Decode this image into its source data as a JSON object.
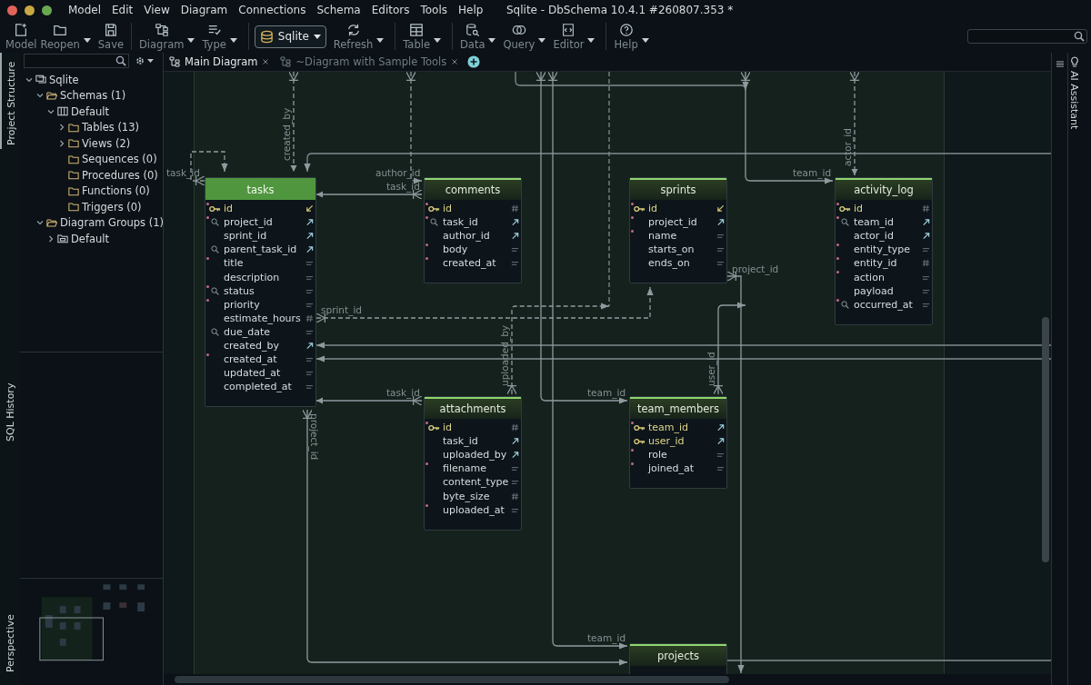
{
  "window": {
    "title": "Sqlite - DbSchema 10.4.1 #260807.353 *"
  },
  "menu": [
    "Model",
    "Edit",
    "View",
    "Diagram",
    "Connections",
    "Schema",
    "Editors",
    "Tools",
    "Help"
  ],
  "toolbar": [
    {
      "label": "Model",
      "kind": "new",
      "dropdown": false
    },
    {
      "label": "Reopen",
      "kind": "folder",
      "dropdown": true
    },
    {
      "label": "Save",
      "kind": "save",
      "dropdown": false
    },
    {
      "label": "Diagram",
      "kind": "diagram",
      "dropdown": true
    },
    {
      "label": "Type",
      "kind": "type",
      "dropdown": true
    },
    {
      "label": "Sqlite",
      "kind": "connection",
      "dropdown": true
    },
    {
      "label": "Refresh",
      "kind": "refresh",
      "dropdown": true
    },
    {
      "label": "Table",
      "kind": "table",
      "dropdown": true
    },
    {
      "label": "Data",
      "kind": "data",
      "dropdown": true
    },
    {
      "label": "Query",
      "kind": "query",
      "dropdown": true
    },
    {
      "label": "Editor",
      "kind": "editor",
      "dropdown": true
    },
    {
      "label": "Help",
      "kind": "help",
      "dropdown": true
    }
  ],
  "left_tabs": [
    {
      "label": "Project Structure",
      "selected": true
    },
    {
      "label": "SQL History",
      "selected": false
    },
    {
      "label": "Perspective",
      "selected": false
    }
  ],
  "right_tabs": [
    {
      "label": "AI Assistant"
    }
  ],
  "tree": [
    {
      "label": "Sqlite",
      "kind": "connection",
      "expanded": true,
      "children": [
        {
          "label": "Schemas (1)",
          "kind": "folder-open",
          "expanded": true,
          "children": [
            {
              "label": "Default",
              "kind": "schema",
              "expanded": true,
              "children": [
                {
                  "label": "Tables (13)",
                  "kind": "folder",
                  "expanded": false
                },
                {
                  "label": "Views (2)",
                  "kind": "folder",
                  "expanded": false
                },
                {
                  "label": "Sequences (0)",
                  "kind": "folder"
                },
                {
                  "label": "Procedures (0)",
                  "kind": "folder"
                },
                {
                  "label": "Functions (0)",
                  "kind": "folder"
                },
                {
                  "label": "Triggers (0)",
                  "kind": "folder"
                }
              ]
            }
          ]
        },
        {
          "label": "Diagram Groups (1)",
          "kind": "folder-open",
          "expanded": true,
          "children": [
            {
              "label": "Default",
              "kind": "group",
              "expanded": false
            }
          ]
        }
      ]
    }
  ],
  "diagram_tabs": [
    {
      "label": "Main Diagram",
      "selected": true
    },
    {
      "label": "~Diagram with Sample Tools",
      "selected": false
    }
  ],
  "tables": [
    {
      "name": "tasks",
      "selected": true,
      "columns": [
        {
          "name": "id",
          "pk": true,
          "indexed": false,
          "required": true,
          "kind": "referenced"
        },
        {
          "name": "project_id",
          "pk": false,
          "indexed": true,
          "required": true,
          "kind": "ref"
        },
        {
          "name": "sprint_id",
          "pk": false,
          "indexed": false,
          "required": false,
          "kind": "ref"
        },
        {
          "name": "parent_task_id",
          "pk": false,
          "indexed": true,
          "required": false,
          "kind": "ref"
        },
        {
          "name": "title",
          "pk": false,
          "indexed": false,
          "required": true,
          "kind": "text"
        },
        {
          "name": "description",
          "pk": false,
          "indexed": false,
          "required": false,
          "kind": "text"
        },
        {
          "name": "status",
          "pk": false,
          "indexed": true,
          "required": true,
          "kind": "text"
        },
        {
          "name": "priority",
          "pk": false,
          "indexed": false,
          "required": true,
          "kind": "text"
        },
        {
          "name": "estimate_hours",
          "pk": false,
          "indexed": false,
          "required": false,
          "kind": "number"
        },
        {
          "name": "due_date",
          "pk": false,
          "indexed": true,
          "required": false,
          "kind": "text"
        },
        {
          "name": "created_by",
          "pk": false,
          "indexed": false,
          "required": false,
          "kind": "ref"
        },
        {
          "name": "created_at",
          "pk": false,
          "indexed": false,
          "required": true,
          "kind": "text"
        },
        {
          "name": "updated_at",
          "pk": false,
          "indexed": false,
          "required": false,
          "kind": "text"
        },
        {
          "name": "completed_at",
          "pk": false,
          "indexed": false,
          "required": false,
          "kind": "text"
        }
      ]
    },
    {
      "name": "comments",
      "selected": false,
      "columns": [
        {
          "name": "id",
          "pk": true,
          "indexed": false,
          "required": true,
          "kind": "number"
        },
        {
          "name": "task_id",
          "pk": false,
          "indexed": true,
          "required": true,
          "kind": "ref"
        },
        {
          "name": "author_id",
          "pk": false,
          "indexed": false,
          "required": false,
          "kind": "ref"
        },
        {
          "name": "body",
          "pk": false,
          "indexed": false,
          "required": true,
          "kind": "text"
        },
        {
          "name": "created_at",
          "pk": false,
          "indexed": false,
          "required": true,
          "kind": "text"
        }
      ]
    },
    {
      "name": "sprints",
      "selected": false,
      "columns": [
        {
          "name": "id",
          "pk": true,
          "indexed": false,
          "required": true,
          "kind": "referenced"
        },
        {
          "name": "project_id",
          "pk": false,
          "indexed": false,
          "required": true,
          "kind": "ref"
        },
        {
          "name": "name",
          "pk": false,
          "indexed": false,
          "required": true,
          "kind": "text"
        },
        {
          "name": "starts_on",
          "pk": false,
          "indexed": false,
          "required": false,
          "kind": "text"
        },
        {
          "name": "ends_on",
          "pk": false,
          "indexed": false,
          "required": false,
          "kind": "text"
        }
      ]
    },
    {
      "name": "activity_log",
      "selected": false,
      "columns": [
        {
          "name": "id",
          "pk": true,
          "indexed": false,
          "required": true,
          "kind": "number"
        },
        {
          "name": "team_id",
          "pk": false,
          "indexed": true,
          "required": true,
          "kind": "ref"
        },
        {
          "name": "actor_id",
          "pk": false,
          "indexed": false,
          "required": false,
          "kind": "ref"
        },
        {
          "name": "entity_type",
          "pk": false,
          "indexed": false,
          "required": true,
          "kind": "text"
        },
        {
          "name": "entity_id",
          "pk": false,
          "indexed": false,
          "required": true,
          "kind": "number"
        },
        {
          "name": "action",
          "pk": false,
          "indexed": false,
          "required": true,
          "kind": "text"
        },
        {
          "name": "payload",
          "pk": false,
          "indexed": false,
          "required": false,
          "kind": "text"
        },
        {
          "name": "occurred_at",
          "pk": false,
          "indexed": true,
          "required": true,
          "kind": "text"
        }
      ]
    },
    {
      "name": "attachments",
      "selected": false,
      "columns": [
        {
          "name": "id",
          "pk": true,
          "indexed": false,
          "required": true,
          "kind": "number"
        },
        {
          "name": "task_id",
          "pk": false,
          "indexed": false,
          "required": false,
          "kind": "ref"
        },
        {
          "name": "uploaded_by",
          "pk": false,
          "indexed": false,
          "required": false,
          "kind": "ref"
        },
        {
          "name": "filename",
          "pk": false,
          "indexed": false,
          "required": true,
          "kind": "text"
        },
        {
          "name": "content_type",
          "pk": false,
          "indexed": false,
          "required": false,
          "kind": "text"
        },
        {
          "name": "byte_size",
          "pk": false,
          "indexed": false,
          "required": false,
          "kind": "number"
        },
        {
          "name": "uploaded_at",
          "pk": false,
          "indexed": false,
          "required": true,
          "kind": "text"
        }
      ]
    },
    {
      "name": "team_members",
      "selected": false,
      "columns": [
        {
          "name": "team_id",
          "pk": true,
          "indexed": false,
          "required": true,
          "kind": "ref"
        },
        {
          "name": "user_id",
          "pk": true,
          "indexed": false,
          "required": false,
          "kind": "ref"
        },
        {
          "name": "role",
          "pk": false,
          "indexed": false,
          "required": true,
          "kind": "text"
        },
        {
          "name": "joined_at",
          "pk": false,
          "indexed": false,
          "required": true,
          "kind": "text"
        }
      ]
    },
    {
      "name": "projects",
      "selected": false
    }
  ],
  "relations": [
    {
      "label": "task_id",
      "dashed": true
    },
    {
      "label": "created_by",
      "dashed": true
    },
    {
      "label": "author_id",
      "dashed": true
    },
    {
      "label": "task_id",
      "dashed": false
    },
    {
      "label": "sprint_id",
      "dashed": true
    },
    {
      "label": "uploaded_by",
      "dashed": true
    },
    {
      "label": "task_id",
      "dashed": false
    },
    {
      "label": "team_id",
      "dashed": false
    },
    {
      "label": "user_id",
      "dashed": false
    },
    {
      "label": "project_id",
      "dashed": false
    },
    {
      "label": "team_id",
      "dashed": false
    },
    {
      "label": "actor_id",
      "dashed": true
    },
    {
      "label": "project_id",
      "dashed": false
    },
    {
      "label": "team_id",
      "dashed": false
    }
  ]
}
